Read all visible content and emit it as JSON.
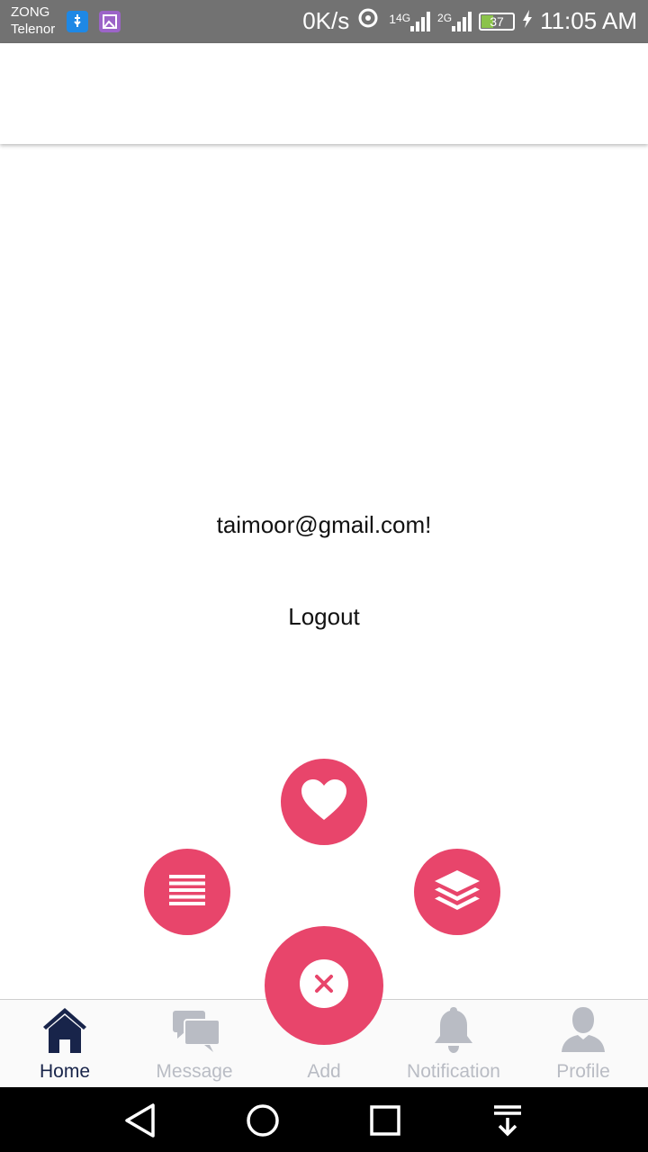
{
  "status_bar": {
    "carrier_1": "ZONG",
    "carrier_2": "Telenor",
    "speed": "0K/s",
    "network_1": "4G",
    "sim_1": "1",
    "network_2": "2G",
    "battery": "37",
    "time": "11:05 AM"
  },
  "main": {
    "email_text": "taimoor@gmail.com!",
    "logout_label": "Logout"
  },
  "fab_menu": {
    "color": "#e8456b",
    "actions": [
      "heart-icon",
      "list-icon",
      "layers-icon"
    ],
    "close_icon": "close-icon"
  },
  "bottom_nav": {
    "active_color": "#18244a",
    "inactive_color": "#b9bcc4",
    "tabs": [
      {
        "label": "Home",
        "icon": "home-icon"
      },
      {
        "label": "Message",
        "icon": "message-icon"
      },
      {
        "label": "Add",
        "icon": "add-icon"
      },
      {
        "label": "Notification",
        "icon": "bell-icon"
      },
      {
        "label": "Profile",
        "icon": "profile-icon"
      }
    ]
  },
  "system_nav": {
    "buttons": [
      "back-icon",
      "home-circle-icon",
      "recents-icon",
      "notification-pull-icon"
    ]
  }
}
